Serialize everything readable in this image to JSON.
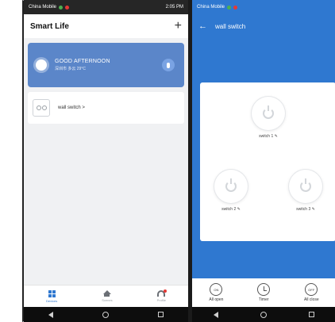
{
  "left_screen": {
    "status": {
      "carrier": "China Mobile",
      "time": "2:05 PM"
    },
    "header": {
      "title": "Smart Life",
      "add": "+"
    },
    "greeting": {
      "line1": "GOOD AFTERNOON",
      "line2": "深圳市 多云 29°C"
    },
    "device": {
      "name": "wall switch >"
    },
    "tabs": [
      {
        "label": "Devices",
        "icon": "grid-icon",
        "active": true
      },
      {
        "label": "Scenes",
        "icon": "home-icon",
        "active": false
      },
      {
        "label": "Profile",
        "icon": "headset-icon",
        "active": false
      }
    ]
  },
  "right_screen": {
    "status": {
      "carrier": "China Mobile",
      "time": ""
    },
    "header": {
      "back": "←",
      "title": "wall switch"
    },
    "switches": [
      {
        "label": "switch 1 ✎"
      },
      {
        "label": "switch 2 ✎"
      },
      {
        "label": "switch 3 ✎"
      }
    ],
    "actions": [
      {
        "icon_text": "ON",
        "label": "All open"
      },
      {
        "icon_text": "",
        "label": "Timer"
      },
      {
        "icon_text": "OFF",
        "label": "All close"
      }
    ]
  },
  "colors": {
    "primary_blue": "#2f78d0",
    "greeting_blue": "#5b86c9",
    "background": "#f0f1f3"
  }
}
